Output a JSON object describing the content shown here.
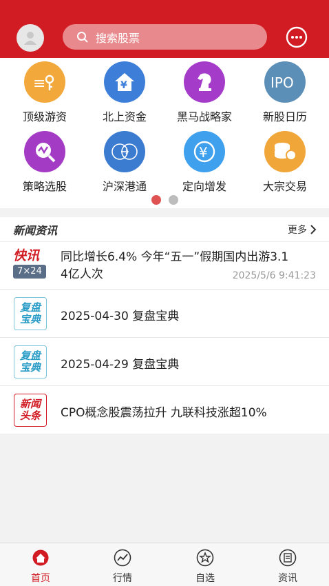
{
  "header": {
    "search_placeholder": "搜索股票"
  },
  "grid": [
    {
      "label": "顶级游资",
      "icon": "money-bag-icon",
      "color": "#f2a83a"
    },
    {
      "label": "北上资金",
      "icon": "yuan-house-icon",
      "color": "#3d7fd8"
    },
    {
      "label": "黑马战略家",
      "icon": "chess-knight-icon",
      "color": "#a53bc9"
    },
    {
      "label": "新股日历",
      "icon": "ipo-icon",
      "color": "#5c8fb7"
    },
    {
      "label": "策略选股",
      "icon": "chart-search-icon",
      "color": "#a43bc5"
    },
    {
      "label": "沪深港通",
      "icon": "hk-connect-icon",
      "color": "#3b7bd0"
    },
    {
      "label": "定向增发",
      "icon": "yuan-circle-icon",
      "color": "#3fa0ee"
    },
    {
      "label": "大宗交易",
      "icon": "coin-stack-icon",
      "color": "#f1a63a"
    }
  ],
  "news": {
    "title": "新闻资讯",
    "more": "更多",
    "items": [
      {
        "badge": "快讯",
        "badge_sub": "7×24",
        "text_line1": "同比增长6.4% 今年“五一”假期国内出游3.1",
        "text_line2": "4亿人次",
        "time": "2025/5/6 9:41:23"
      },
      {
        "badge_top": "复盘",
        "badge_bottom": "宝典",
        "text": "2025-04-30 复盘宝典"
      },
      {
        "badge_top": "复盘",
        "badge_bottom": "宝典",
        "text": "2025-04-29 复盘宝典"
      },
      {
        "badge_top": "新闻",
        "badge_bottom": "头条",
        "text": "CPO概念股震荡拉升 九联科技涨超10%"
      }
    ]
  },
  "bottom_nav": [
    {
      "label": "首页",
      "icon": "home-icon",
      "active": true
    },
    {
      "label": "行情",
      "icon": "market-chart-icon",
      "active": false
    },
    {
      "label": "自选",
      "icon": "star-icon",
      "active": false
    },
    {
      "label": "资讯",
      "icon": "news-icon",
      "active": false
    }
  ],
  "colors": {
    "brand": "#d21c24",
    "active": "#d21c24"
  }
}
